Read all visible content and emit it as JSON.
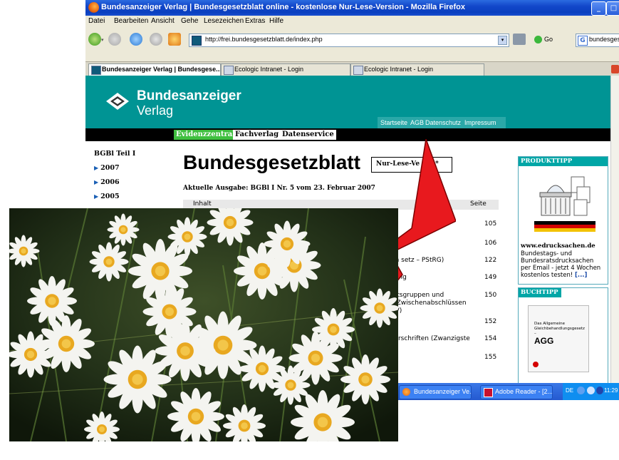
{
  "browser": {
    "title": "Bundesanzeiger Verlag | Bundesgesetzblatt online - kostenlose Nur-Lese-Version - Mozilla Firefox",
    "menu": [
      "Datei",
      "Bearbeiten",
      "Ansicht",
      "Gehe",
      "Lesezeichen",
      "Extras",
      "Hilfe"
    ],
    "url": "http://frei.bundesgesetzblatt.de/index.php",
    "go_label": "Go",
    "search_value": "bundesgesetzblatt",
    "tabs": [
      {
        "label": "Bundesanzeiger Verlag | Bundesgese..."
      },
      {
        "label": "Ecologic Intranet - Login"
      },
      {
        "label": "Ecologic Intranet - Login"
      }
    ]
  },
  "site": {
    "logo_top": "Bundesanzeiger",
    "logo_bottom": "Verlag",
    "top_links": [
      "Startseite",
      "AGB",
      "Datenschutz",
      "Impressum"
    ],
    "nav": [
      "Evidenzzentrale",
      "Fachverlag",
      "Datenservice"
    ],
    "sidebar": {
      "heading": "BGBl Teil I",
      "years": [
        "2007",
        "2006",
        "2005"
      ]
    },
    "title": "Bundesgesetzblatt",
    "badge": "Nur-Lese-Ve",
    "badge_tail": "*",
    "current_issue": "Aktuelle Ausgabe: BGBl I Nr. 5 vom 23. Februar 2007",
    "table_header": {
      "left": "Inhalt",
      "right": "Seite"
    },
    "rows": [
      {
        "text": "",
        "page": "105"
      },
      {
        "text": "rm   setz – PStRG)",
        "page": "106"
      },
      {
        "text": "",
        "page": "122"
      },
      {
        "text": "nung",
        "page": "149"
      },
      {
        "text": "tutsgruppen und",
        "text2": "d Zwischenabschlüssen",
        "text3": "ÜV)",
        "page": "150"
      },
      {
        "text": "",
        "page": "152"
      },
      {
        "text": "Vorschriften (Zwanzigste",
        "page": "154"
      },
      {
        "text": "",
        "page": "155"
      }
    ],
    "produkt": {
      "heading": "PRODUKTTIPP",
      "site": "www.edrucksachen.de",
      "desc": "Bundestags- und Bundesratsdrucksachen per Email - jetzt 4 Wochen kostenlos testen!",
      "more": "[...]"
    },
    "buchtipp": {
      "heading": "BUCHTIPP",
      "book_small": "Das Allgemeine Gleichbehandlungsgesetz –",
      "book_title": "AGG"
    }
  },
  "taskbar": {
    "buttons": [
      "Bundesanzeiger Ve...",
      "Adobe Reader - [2..."
    ],
    "lang": "DE",
    "time": "11:29"
  },
  "colors": {
    "header_teal": "#009494",
    "nav_active": "#3fbf3f",
    "arrow_red": "#e8191e"
  }
}
